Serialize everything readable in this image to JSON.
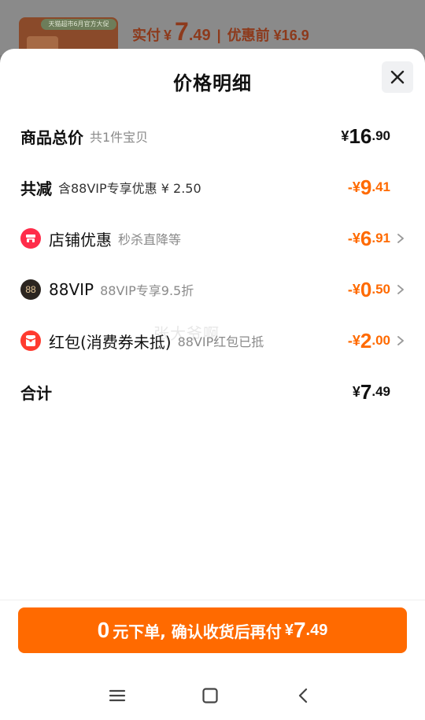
{
  "background": {
    "thumb_tag": "天猫超市6月官方大促",
    "actual_label": "实付",
    "actual_currency": "¥",
    "actual_int": "7",
    "actual_dec": ".49",
    "separator": "|",
    "original_price": "优惠前 ¥16.9"
  },
  "sheet": {
    "title": "价格明细",
    "close_icon": "close-icon"
  },
  "rows": {
    "total": {
      "label": "商品总价",
      "sub": "共1件宝贝",
      "currency": "¥",
      "int": "16",
      "dec": ".90"
    },
    "reduction": {
      "label": "共减",
      "sub": "含88VIP专享优惠 ¥ 2.50",
      "prefix": "-¥",
      "int": "9",
      "dec": ".41"
    },
    "store": {
      "icon": "store-icon",
      "label": "店铺优惠",
      "sub": "秒杀直降等",
      "prefix": "-¥",
      "int": "6",
      "dec": ".91"
    },
    "vip": {
      "icon_text": "88",
      "label": "88VIP",
      "sub": "88VIP专享9.5折",
      "prefix": "-¥",
      "int": "0",
      "dec": ".50"
    },
    "redpacket": {
      "icon": "red-packet-icon",
      "label": "红包(消费券未抵)",
      "sub": "88VIP红包已抵",
      "prefix": "-¥",
      "int": "2",
      "dec": ".00"
    },
    "sum": {
      "label": "合计",
      "currency": "¥",
      "int": "7",
      "dec": ".49"
    }
  },
  "watermark": "张大爷啊",
  "cta": {
    "num": "0",
    "text": "元下单, 确认收货后再付",
    "currency": "¥",
    "int": "7",
    "dec": ".49"
  },
  "navbar": {
    "menu_icon": "menu-icon",
    "home_icon": "home-icon",
    "back_icon": "back-icon"
  },
  "colors": {
    "accent": "#ff6a00",
    "text": "#111111",
    "sub": "#8a8a8a"
  }
}
